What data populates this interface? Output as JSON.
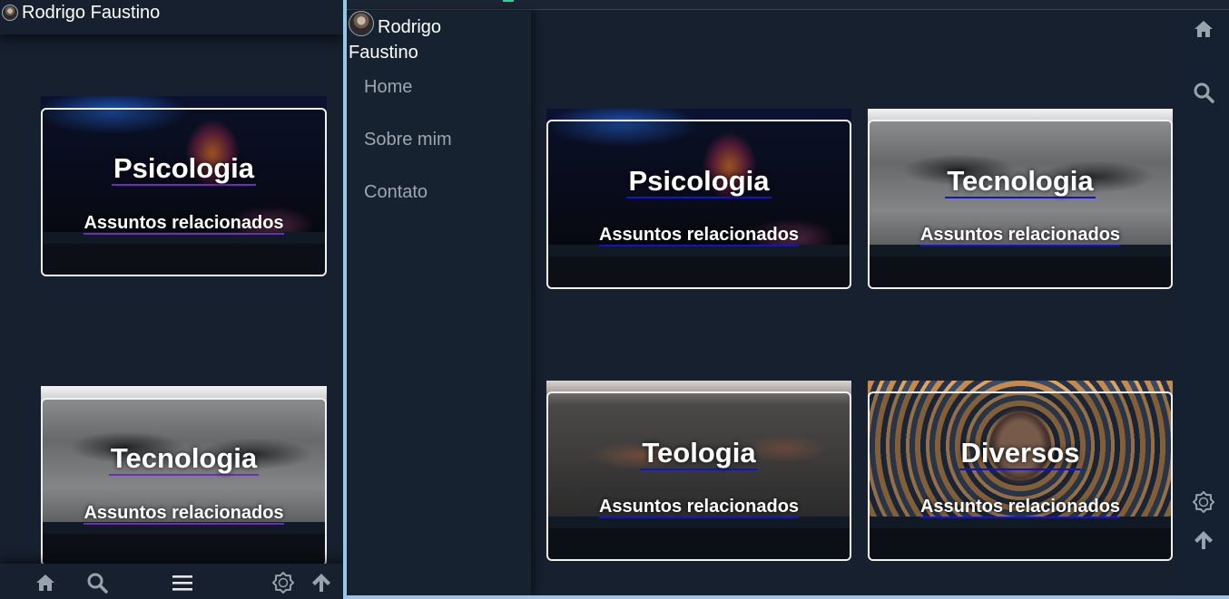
{
  "mobile": {
    "brand": "Rodrigo Faustino",
    "cards": [
      {
        "title": "Psicologia",
        "subtitle": "Assuntos relacionados",
        "image": "psicologia-hand-brain-image"
      },
      {
        "title": "Tecnologia",
        "subtitle": "Assuntos relacionados",
        "image": "tecnologia-robot-hands-image"
      }
    ],
    "bottom_bar": [
      "home-icon",
      "search-icon",
      "menu-icon",
      "settings-icon",
      "arrow-up-icon"
    ]
  },
  "desktop": {
    "brand_first": "Rodrigo",
    "brand_last": "Faustino",
    "nav": [
      "Home",
      "Sobre mim",
      "Contato"
    ],
    "cards": [
      {
        "title": "Psicologia",
        "subtitle": "Assuntos relacionados",
        "image": "psicologia-hand-brain-image"
      },
      {
        "title": "Tecnologia",
        "subtitle": "Assuntos relacionados",
        "image": "tecnologia-robot-hands-image"
      },
      {
        "title": "Teologia",
        "subtitle": "Assuntos relacionados",
        "image": "teologia-hands-image"
      },
      {
        "title": "Diversos",
        "subtitle": "Assuntos relacionados",
        "image": "diversos-portrait-image"
      }
    ],
    "rail": [
      "home-icon",
      "search-icon",
      "settings-icon",
      "arrow-up-icon"
    ]
  },
  "colors": {
    "background": "#16202e",
    "sidebar": "#172231",
    "card_border": "#f1f1f1",
    "mobile_link_underline": "#6b2fb8",
    "desktop_link_underline": "#1313c9",
    "nav_text": "#9ea5ae",
    "window_border": "#9cc3e8"
  }
}
